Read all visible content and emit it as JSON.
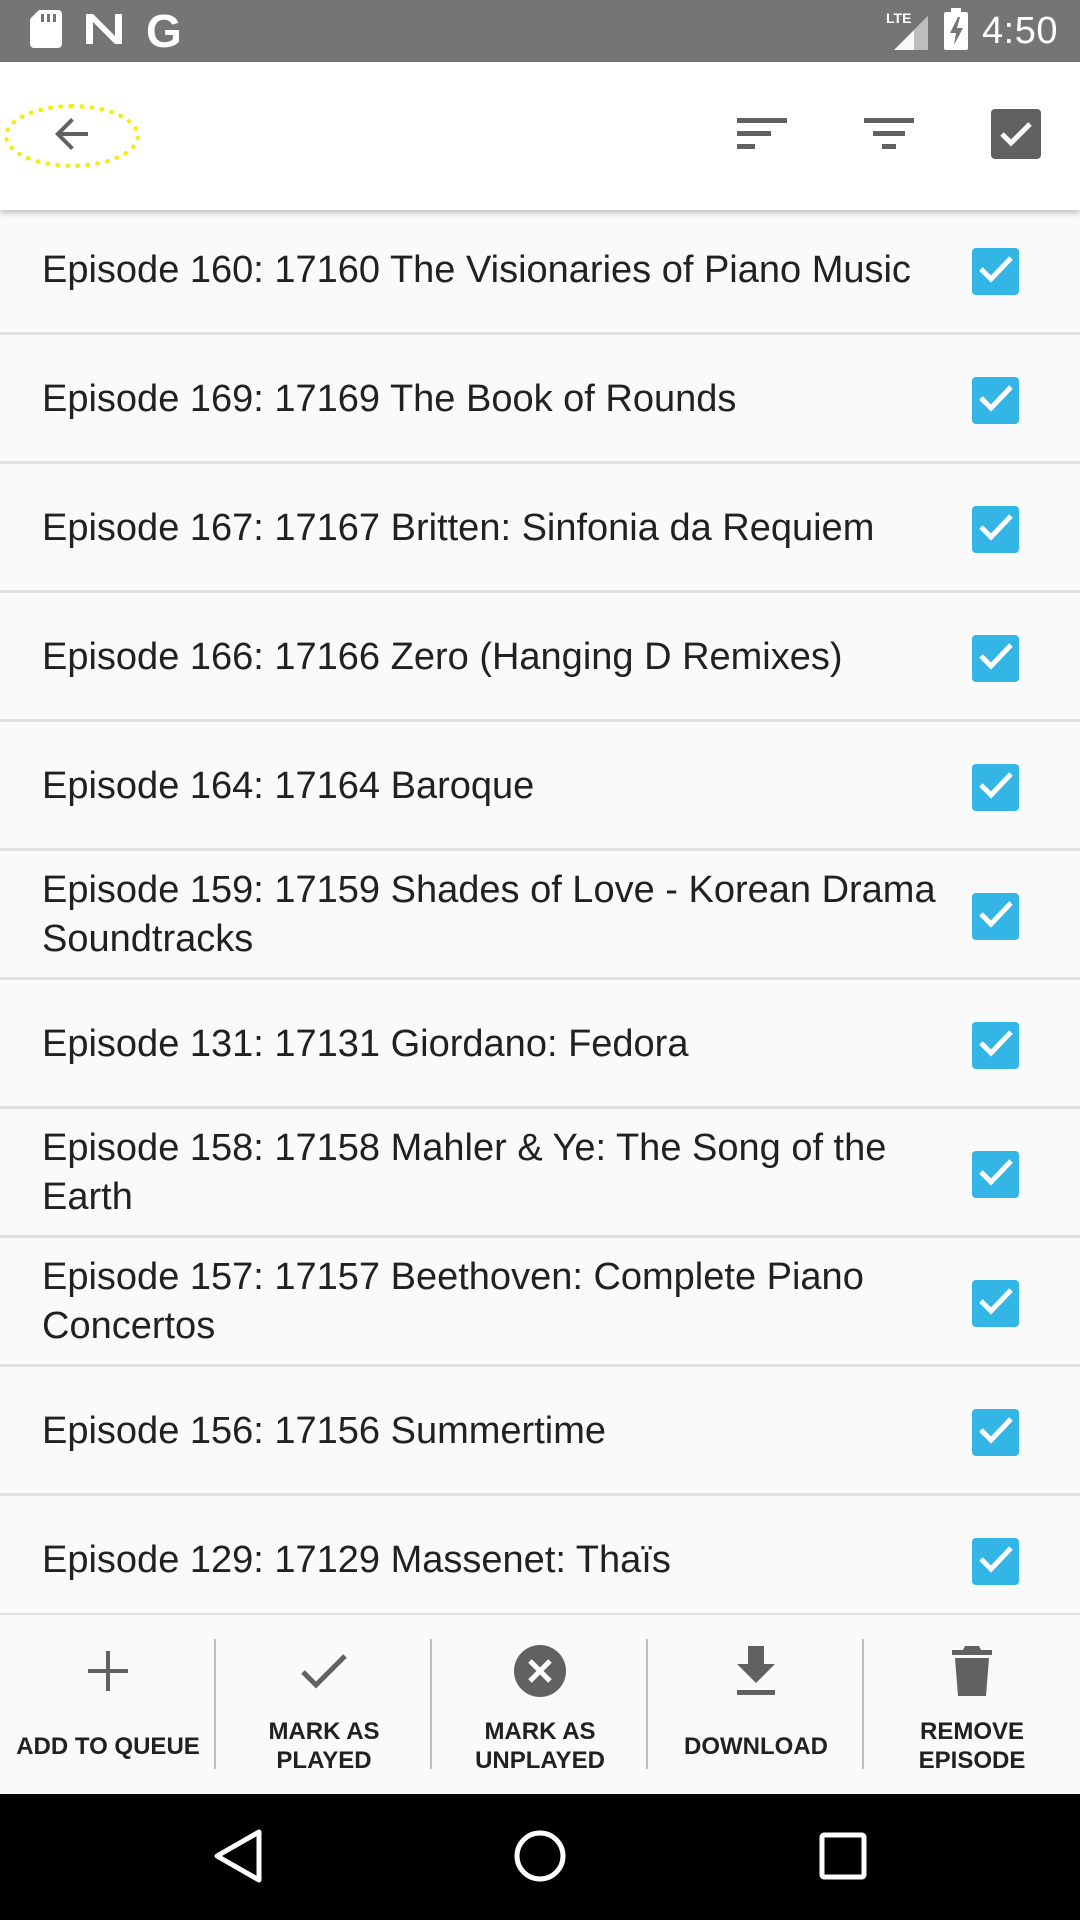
{
  "status_bar": {
    "time": "4:50",
    "network": "LTE",
    "left_icons": [
      "sd-card-icon",
      "n-notification-icon",
      "google-icon"
    ],
    "google_glyph": "G"
  },
  "toolbar": {
    "icons": [
      "back-arrow-icon",
      "sort-icon",
      "filter-icon",
      "select-all-icon"
    ]
  },
  "episodes": [
    {
      "title": "Episode 160: 17160 The Visionaries of Piano Music",
      "checked": true
    },
    {
      "title": "Episode 169: 17169 The Book of Rounds",
      "checked": true
    },
    {
      "title": "Episode 167: 17167 Britten: Sinfonia da Requiem",
      "checked": true
    },
    {
      "title": "Episode 166: 17166 Zero (Hanging D Remixes)",
      "checked": true
    },
    {
      "title": "Episode 164: 17164 Baroque",
      "checked": true
    },
    {
      "title": "Episode 159: 17159 Shades of Love - Korean Drama Soundtracks",
      "checked": true
    },
    {
      "title": "Episode 131: 17131 Giordano: Fedora",
      "checked": true
    },
    {
      "title": "Episode 158: 17158 Mahler & Ye: The Song of the Earth",
      "checked": true
    },
    {
      "title": "Episode 157: 17157 Beethoven: Complete Piano Concertos",
      "checked": true
    },
    {
      "title": "Episode 156: 17156 Summertime",
      "checked": true
    },
    {
      "title": "Episode 129: 17129 Massenet: Thaïs",
      "checked": true
    }
  ],
  "actions": [
    {
      "label": "ADD TO QUEUE",
      "icon": "plus-icon"
    },
    {
      "label": "MARK AS\nPLAYED",
      "icon": "check-icon"
    },
    {
      "label": "MARK AS\nUNPLAYED",
      "icon": "cancel-circle-icon"
    },
    {
      "label": "DOWNLOAD",
      "icon": "download-icon"
    },
    {
      "label": "REMOVE\nEPISODE",
      "icon": "trash-icon"
    }
  ],
  "colors": {
    "status_bar": "#757575",
    "checkbox": "#33b5e5",
    "highlight_ring": "#f2ee1c",
    "nav_bar": "#000000"
  }
}
